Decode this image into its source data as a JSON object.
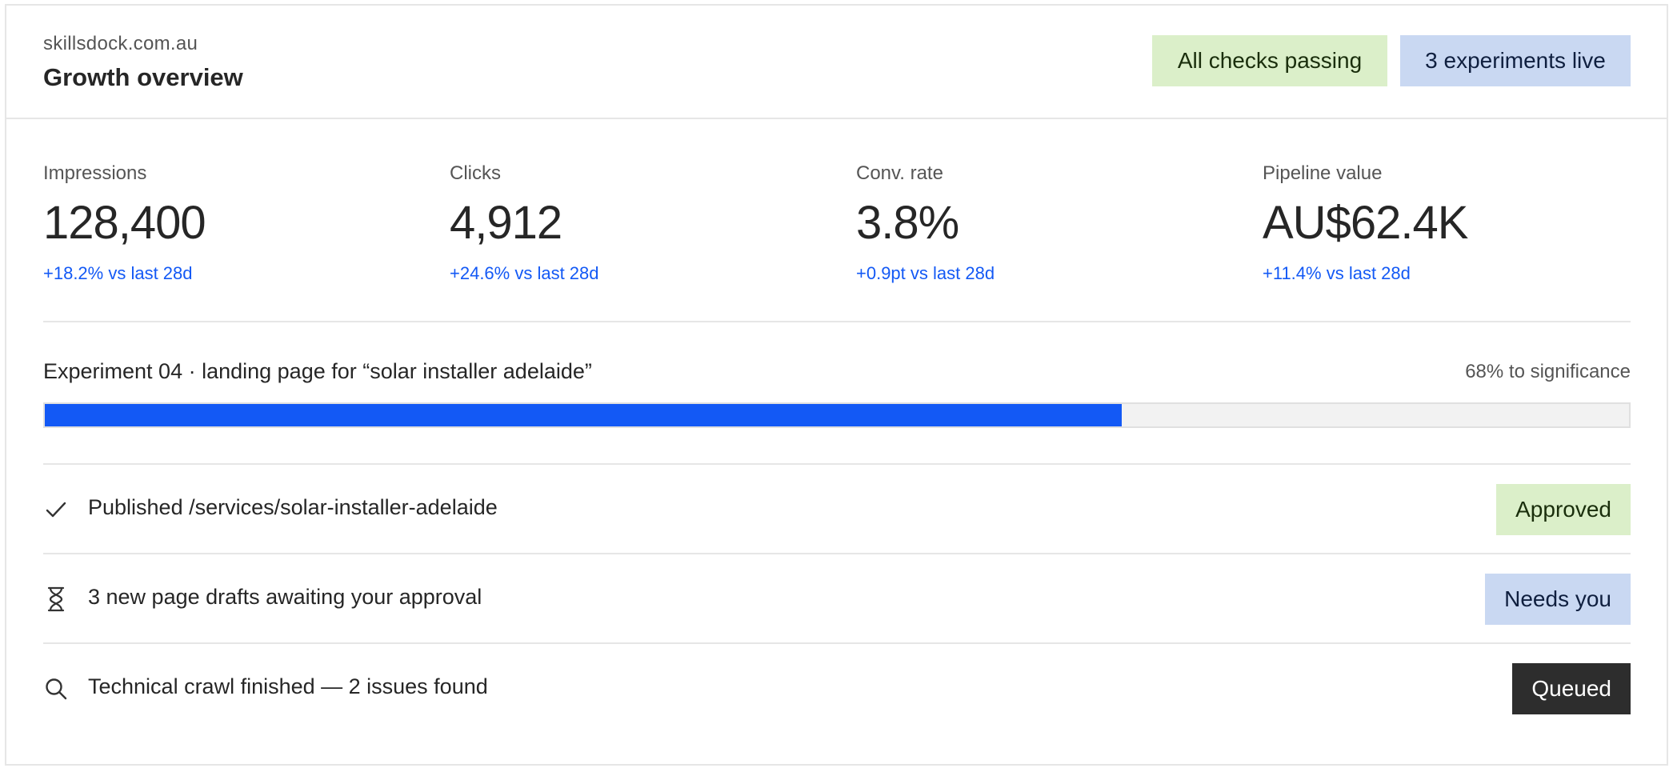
{
  "header": {
    "domain": "skillsdock.com.au",
    "title": "Growth overview",
    "status_pills": [
      {
        "label": "All checks passing",
        "color": "#dbefc9"
      },
      {
        "label": "3 experiments live",
        "color": "#c9d8f2"
      }
    ]
  },
  "metrics": [
    {
      "label": "Impressions",
      "value": "128,400",
      "delta": "+18.2% vs last 28d"
    },
    {
      "label": "Clicks",
      "value": "4,912",
      "delta": "+24.6% vs last 28d"
    },
    {
      "label": "Conv. rate",
      "value": "3.8%",
      "delta": "+0.9pt vs last 28d"
    },
    {
      "label": "Pipeline value",
      "value": "AU$62.4K",
      "delta": "+11.4% vs last 28d"
    }
  ],
  "experiment": {
    "title": "Experiment 04 · landing page for “solar installer adelaide”",
    "significance_label": "68% to significance",
    "progress_percent": 68,
    "accent_color": "#1359f5"
  },
  "activity": [
    {
      "icon": "check-icon",
      "text": "Published /services/solar-installer-adelaide",
      "badge": "Approved"
    },
    {
      "icon": "hourglass-icon",
      "text": "3 new page drafts awaiting your approval",
      "badge": "Needs you"
    },
    {
      "icon": "search-icon",
      "text": "Technical crawl finished — 2 issues found",
      "badge": "Queued"
    }
  ]
}
